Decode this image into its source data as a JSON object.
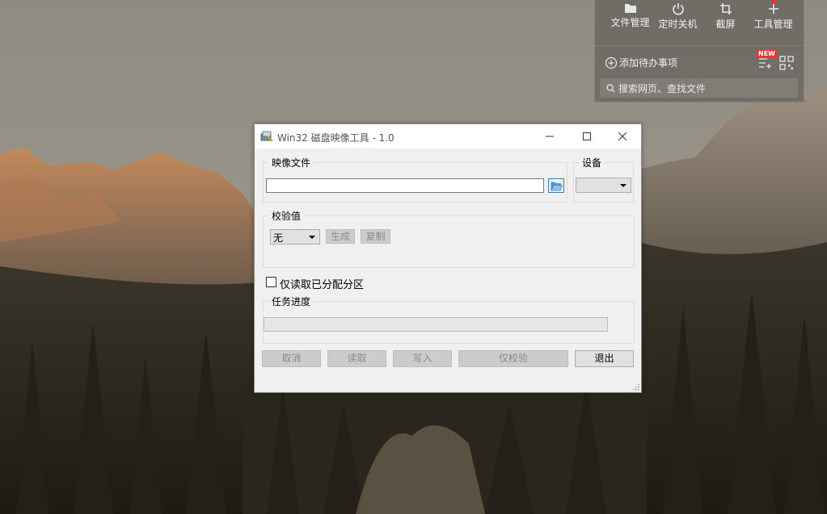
{
  "desktop_widget": {
    "tools": [
      {
        "label": "文件管理",
        "icon": "folder-icon"
      },
      {
        "label": "定时关机",
        "icon": "power-icon"
      },
      {
        "label": "截屏",
        "icon": "crop-icon"
      },
      {
        "label": "工具管理",
        "icon": "plus-icon"
      }
    ],
    "todo_label": "添加待办事项",
    "new_badge": "NEW",
    "search_placeholder": "搜索网页、查找文件"
  },
  "window": {
    "title": "Win32 磁盘映像工具 - 1.0",
    "image_file_group": "映像文件",
    "image_file_value": "",
    "device_group": "设备",
    "device_value": "",
    "hash_group": "校验值",
    "hash_selected": "无",
    "generate_button": "生成",
    "copy_button": "复制",
    "readonly_checkbox_label": "仅读取已分配分区",
    "readonly_checked": false,
    "progress_group": "任务进度",
    "progress_percent": 0,
    "buttons": {
      "cancel": "取消",
      "read": "读取",
      "write": "写入",
      "verify": "仅校验",
      "exit": "退出"
    }
  },
  "colors": {
    "window_bg": "#f0f0f0",
    "titlebar_bg": "#ffffff",
    "disabled_button_bg": "#cccccc",
    "accent_blue": "#3c7fb1"
  }
}
